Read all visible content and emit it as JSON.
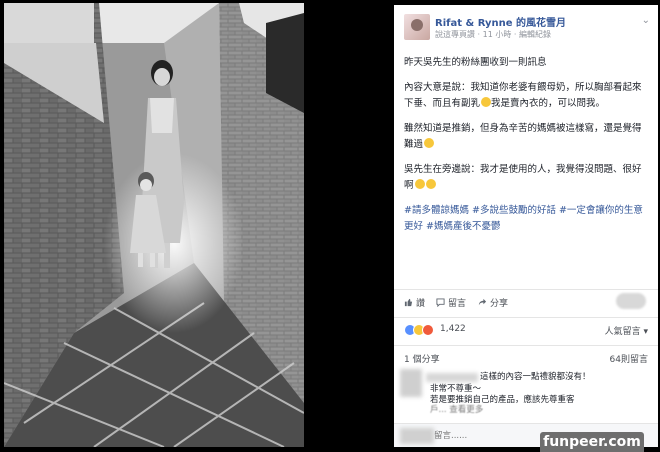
{
  "post": {
    "page_name": "Rifat & Rynne 的風花雪月",
    "follow_label": "說這專頁讚",
    "time": "11 小時",
    "edited": "編輯紀錄",
    "paragraphs": [
      "昨天吳先生的粉絲團收到一則訊息",
      "內容大意是說：我知道你老婆有餵母奶，所以胸部看起來下垂、而且有副乳",
      "我是賣內衣的，可以問我。",
      "雖然知道是推銷，但身為辛苦的媽媽被這樣寫，還是覺得難過",
      "吳先生在旁邊說：我才是使用的人，我覺得沒問題、很好啊"
    ],
    "hashtags": "#請多體諒媽媽 #多說些鼓勵的好話 #一定會讓你的生意更好 #媽媽產後不憂鬱"
  },
  "actions": {
    "like": "讚",
    "comment": "留言",
    "share": "分享"
  },
  "reactions": {
    "count": "1,422",
    "sort": "人氣留言"
  },
  "stats": {
    "shares": "1 個分享",
    "comments": "64則留言"
  },
  "comment": {
    "line1": "這樣的內容一點禮貌都沒有！",
    "line2": "非常不尊重～",
    "line3": "若是要推銷自己的產品，應該先尊重客",
    "line4": "戶... 查看更多"
  },
  "compose": {
    "placeholder": "留言......"
  },
  "watermark": "funpeer.com"
}
